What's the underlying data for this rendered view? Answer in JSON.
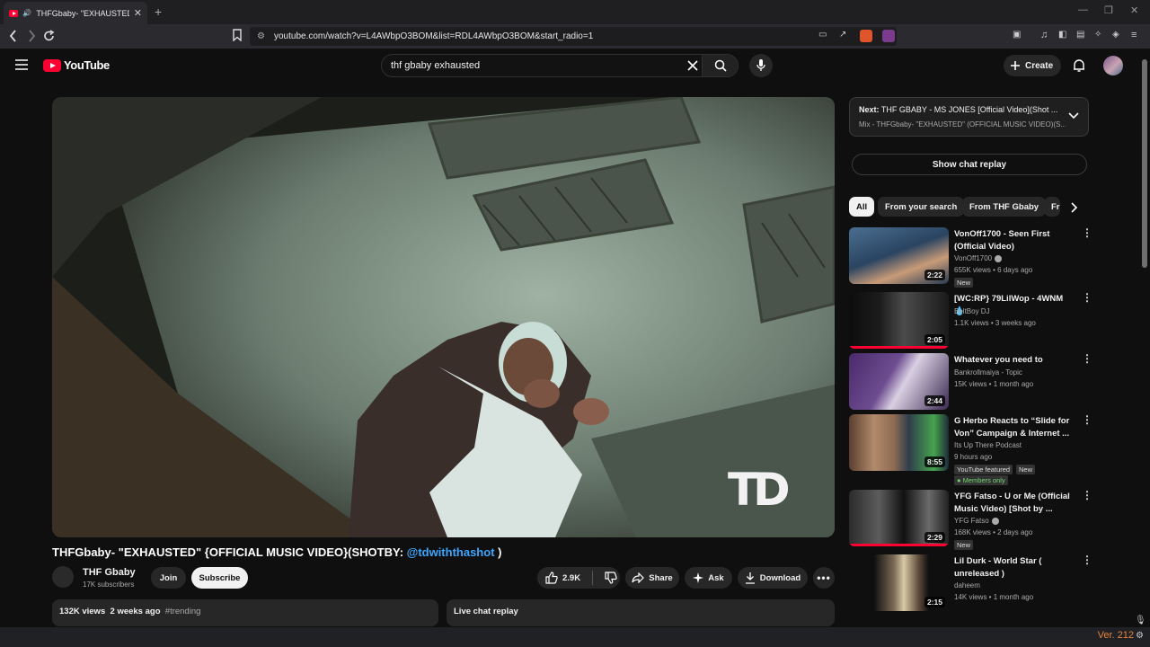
{
  "browser": {
    "tab_title": "THFGbaby- \"EXHAUSTED\" {O",
    "url": "youtube.com/watch?v=L4AWbpO3BOM&list=RDL4AWbpO3BOM&start_radio=1",
    "new_tab": "+",
    "close": "✕"
  },
  "header": {
    "logo": "YouTube",
    "search_query": "thf gbaby exhausted",
    "create_label": "Create"
  },
  "video": {
    "title_prefix": "THFGbaby- \"EXHAUSTED\" {OFFICIAL MUSIC VIDEO}(SHOTBY: ",
    "title_mention": "@tdwiththashot",
    "title_suffix": " )",
    "channel": "THF Gbaby",
    "subscribers": "17K subscribers",
    "join_label": "Join",
    "subscribe_label": "Subscribe",
    "likes": "2.9K",
    "share_label": "Share",
    "ask_label": "Ask",
    "download_label": "Download",
    "views": "132K views",
    "age": "2 weeks ago",
    "hashtag": "#trending",
    "live_chat_label": "Live chat replay",
    "watermark": "TD"
  },
  "sidebar": {
    "next_prefix": "Next:",
    "next_title": "THF GBABY - MS JONES [Official Video](Shot ...",
    "next_sub": "Mix - THFGbaby- \"EXHAUSTED\" (OFFICIAL MUSIC VIDEO)(S...",
    "show_chat": "Show chat replay",
    "chips": [
      "All",
      "From your search",
      "From THF Gbaby",
      "Fr"
    ],
    "recs": [
      {
        "title": "VonOff1700 - Seen First (Official Video)",
        "channel": "VonOff1700",
        "meta": "655K views • 6 days ago",
        "badge": "New",
        "duration": "2:22"
      },
      {
        "title": "[WC:RP} 79LilWop - 4WNM",
        "channel": "BeltBoy DJ",
        "meta": "1.1K views • 3 weeks ago",
        "badge": "",
        "duration": "2:05"
      },
      {
        "title": "Whatever you need to",
        "channel": "Bankrollmaiya - Topic",
        "meta": "15K views • 1 month ago",
        "badge": "",
        "duration": "2:44"
      },
      {
        "title": "G Herbo Reacts to “Slide for Von” Campaign & Internet ...",
        "channel": "Its Up There Podcast",
        "meta": "9 hours ago",
        "badge": "New",
        "badge2": "YouTube featured",
        "members": "Members only",
        "duration": "8:55"
      },
      {
        "title": "YFG Fatso - U or Me (Official Music Video) [Shot by ...",
        "channel": "YFG Fatso",
        "meta": "168K views • 2 days ago",
        "badge": "New",
        "duration": "2:29"
      },
      {
        "title": "Lil Durk - World Star ( unreleased )",
        "channel": "daheem",
        "meta": "14K views • 1 month ago",
        "badge": "",
        "duration": "2:15"
      }
    ]
  },
  "taskbar": {
    "version": "Ver. 212"
  }
}
